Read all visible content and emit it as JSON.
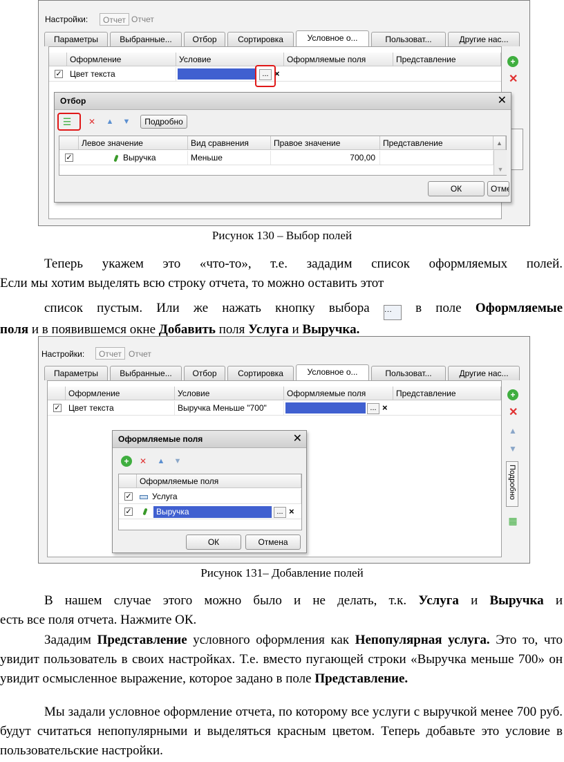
{
  "shot1": {
    "settings_label": "Настройки:",
    "settings_button": "Отчет",
    "settings_text": "Отчет",
    "tabs": [
      "Параметры",
      "Выбранные...",
      "Отбор",
      "Сортировка",
      "Условное о...",
      "Пользоват...",
      "Другие нас..."
    ],
    "columns": [
      "Оформление",
      "Условие",
      "Оформляемые поля",
      "Представление"
    ],
    "row": {
      "appearance": "Цвет текста"
    },
    "filter_dialog": {
      "title": "Отбор",
      "detail_button": "Подробно",
      "columns": [
        "Левое значение",
        "Вид сравнения",
        "Правое значение",
        "Представление"
      ],
      "row": {
        "left": "Выручка",
        "comparison": "Меньше",
        "right": "700,00"
      },
      "ok": "ОК",
      "cancel": "Отмена"
    }
  },
  "caption1": "Рисунок 130 – Выбор полей",
  "para1": {
    "line1": "Теперь укажем это «что-то», т.е. зададим список оформляемых полей.",
    "line2": "Если мы хотим выделять всю строку отчета, то можно оставить этот",
    "line3_a": "список пустым. Или же нажать кнопку выбора",
    "line3_b": "в поле",
    "b1": "Оформляемые",
    "b2": "поля",
    "t2": "и в появившемся окне",
    "b3": "Добавить",
    "t3": "поля",
    "b4": "Услуга",
    "t4": "и",
    "b5": "Выручка."
  },
  "shot2": {
    "settings_label": "Настройки:",
    "settings_button": "Отчет",
    "settings_text": "Отчет",
    "tabs": [
      "Параметры",
      "Выбранные...",
      "Отбор",
      "Сортировка",
      "Условное о...",
      "Пользоват...",
      "Другие нас..."
    ],
    "columns": [
      "Оформление",
      "Условие",
      "Оформляемые поля",
      "Представление"
    ],
    "row": {
      "appearance": "Цвет текста",
      "condition": "Выручка Меньше \"700\""
    },
    "side_tab": "Подробно",
    "fields_dialog": {
      "title": "Оформляемые поля",
      "column": "Оформляемые поля",
      "rows": [
        "Услуга",
        "Выручка"
      ],
      "ok": "ОК",
      "cancel": "Отмена"
    }
  },
  "caption2": "Рисунок 131– Добавление полей",
  "para2": {
    "a": "В нашем случае этого можно было и не делать, т.к.",
    "b1": "Услуга",
    "t1": "и",
    "b2": "Выручка",
    "t2": "и",
    "line2": "есть все поля отчета. Нажмите ОК."
  },
  "para3": {
    "a": "Зададим",
    "b1": "Представление",
    "t1": "условного оформления как",
    "b2": "Непопулярная",
    "b3": "услуга.",
    "t2": "Это то, что увидит пользователь в своих настройках. Т.е. вместо пугающей строки «Выручка меньше 700» он увидит осмысленное выражение, которое задано в поле",
    "b4": "Представление."
  },
  "para4": "Мы задали условное оформление отчета, по которому все услуги с выручкой менее 700 руб. будут считаться непопулярными и выделяться красным цветом. Теперь добавьте это условие в пользовательские настройки.",
  "colors": {
    "selection": "#4060d0",
    "highlight": "#e01818",
    "add_green": "#3fae3f",
    "delete_red": "#e03030",
    "arrow_blue": "#5b8fd0"
  }
}
